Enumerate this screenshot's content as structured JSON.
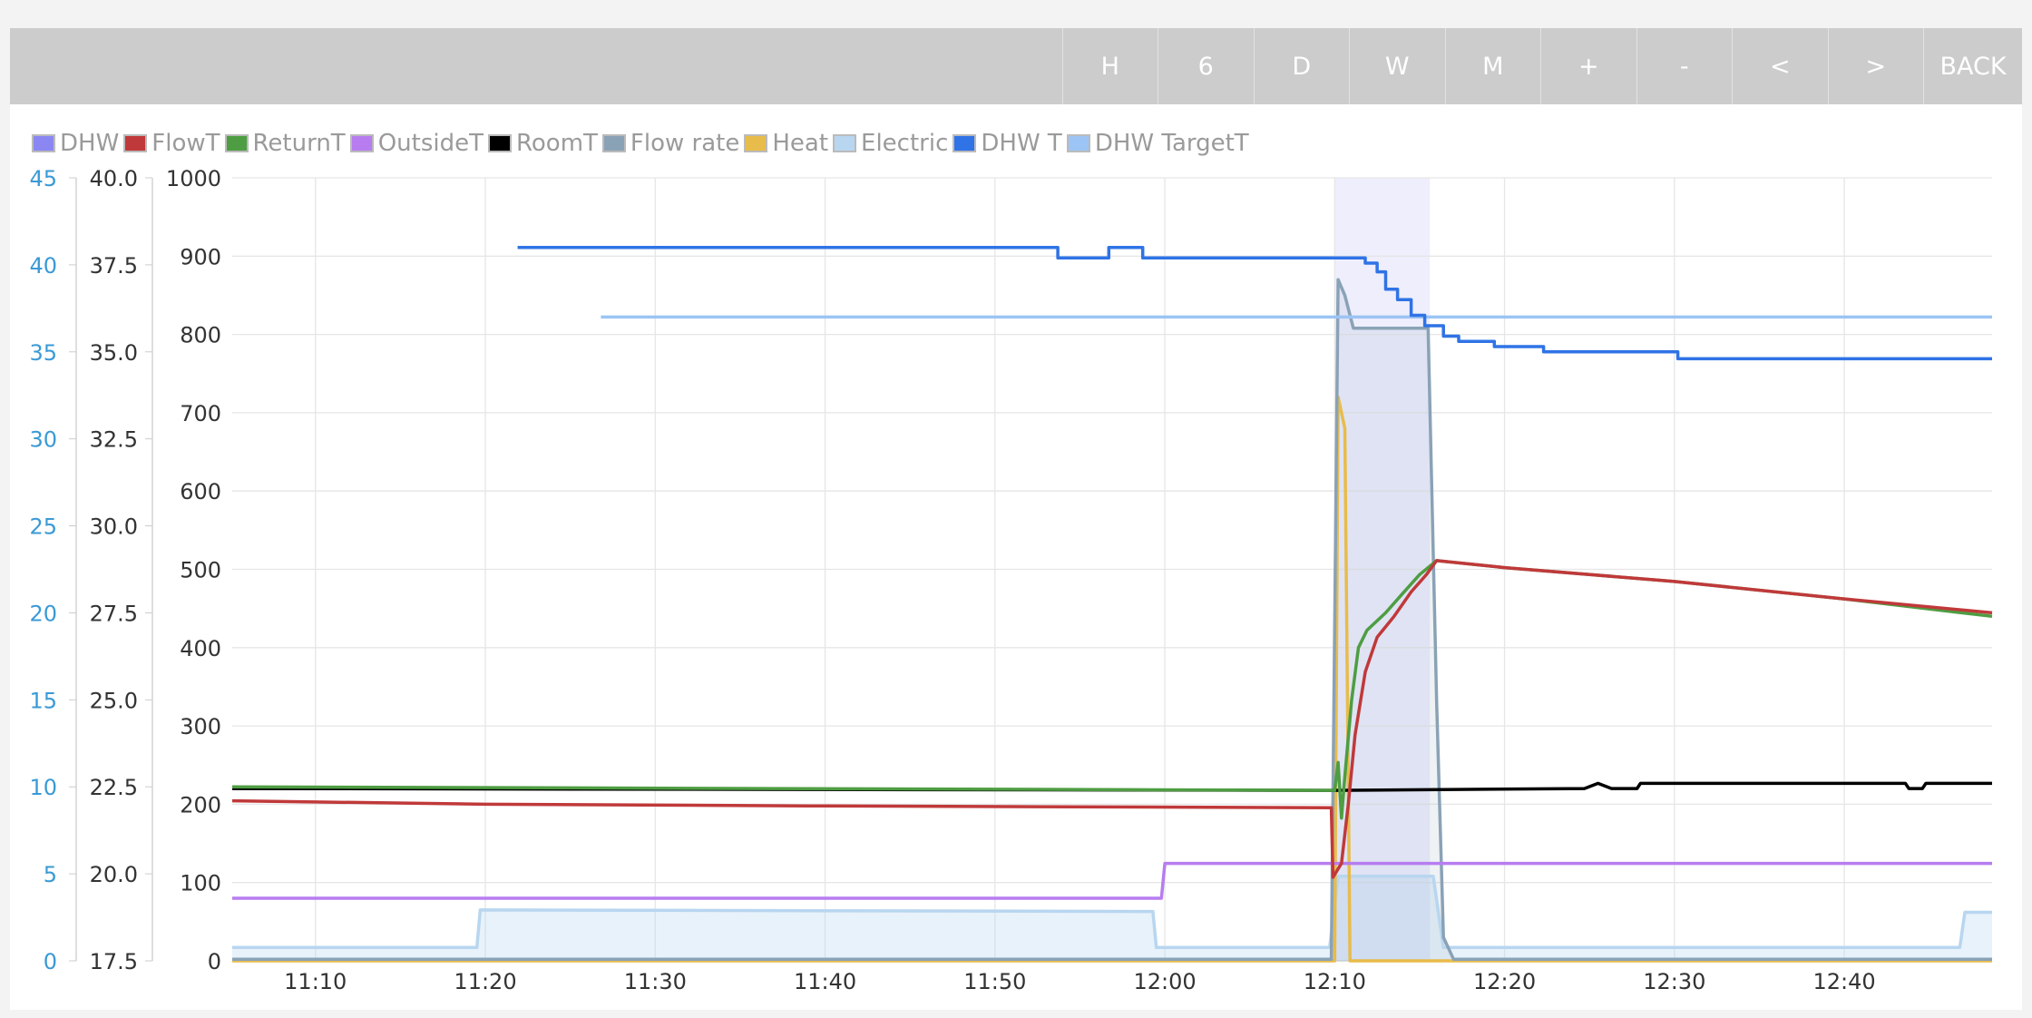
{
  "toolbar": {
    "buttons": [
      "H",
      "6",
      "D",
      "W",
      "M",
      "+",
      "-",
      "<",
      ">",
      "BACK"
    ]
  },
  "legend": [
    {
      "label": "DHW",
      "color": "#8a87f2"
    },
    {
      "label": "FlowT",
      "color": "#c0393a"
    },
    {
      "label": "ReturnT",
      "color": "#4e9d42"
    },
    {
      "label": "OutsideT",
      "color": "#b77df0"
    },
    {
      "label": "RoomT",
      "color": "#000000"
    },
    {
      "label": "Flow rate",
      "color": "#8aa2b6"
    },
    {
      "label": "Heat",
      "color": "#e8bc4a"
    },
    {
      "label": "Electric",
      "color": "#b8d6f0"
    },
    {
      "label": "DHW T",
      "color": "#2f73e6"
    },
    {
      "label": "DHW TargetT",
      "color": "#9cc4f4"
    }
  ],
  "chart_data": {
    "type": "line",
    "x_ticks": [
      "11:10",
      "11:20",
      "11:30",
      "11:40",
      "11:50",
      "12:00",
      "12:10",
      "12:20",
      "12:30",
      "12:40"
    ],
    "x_range_minutes": [
      5.1,
      108.7
    ],
    "y_axis_power": {
      "ticks": [
        "0",
        "100",
        "200",
        "300",
        "400",
        "500",
        "600",
        "700",
        "800",
        "900",
        "1000"
      ],
      "range": [
        0,
        1000
      ]
    },
    "y_axis_temp": {
      "ticks": [
        "17.5",
        "20.0",
        "22.5",
        "25.0",
        "27.5",
        "30.0",
        "32.5",
        "35.0",
        "37.5",
        "40.0"
      ],
      "range": [
        17.5,
        40.0
      ]
    },
    "y_axis_dhw": {
      "ticks": [
        "0",
        "5",
        "10",
        "15",
        "20",
        "25",
        "30",
        "35",
        "40",
        "45"
      ],
      "range": [
        0,
        45
      ],
      "color": "#3a9ad6"
    },
    "dhw_band_minutes": [
      70.0,
      75.6
    ],
    "grid": true,
    "legend_position": "top-left",
    "series": [
      {
        "name": "DHW T",
        "color": "#2f73e6",
        "axis": "dhw",
        "points": [
          [
            21.9,
            41.0
          ],
          [
            53.7,
            41.0
          ],
          [
            53.7,
            40.4
          ],
          [
            56.7,
            40.4
          ],
          [
            56.7,
            41.0
          ],
          [
            58.7,
            41.0
          ],
          [
            58.7,
            40.4
          ],
          [
            71.8,
            40.4
          ],
          [
            71.8,
            40.1
          ],
          [
            72.5,
            40.1
          ],
          [
            72.5,
            39.6
          ],
          [
            73.0,
            39.6
          ],
          [
            73.0,
            38.6
          ],
          [
            73.7,
            38.6
          ],
          [
            73.7,
            38.0
          ],
          [
            74.5,
            38.0
          ],
          [
            74.5,
            37.1
          ],
          [
            75.3,
            37.1
          ],
          [
            75.3,
            36.5
          ],
          [
            76.4,
            36.5
          ],
          [
            76.4,
            35.9
          ],
          [
            77.3,
            35.9
          ],
          [
            77.3,
            35.6
          ],
          [
            79.4,
            35.6
          ],
          [
            79.4,
            35.3
          ],
          [
            82.3,
            35.3
          ],
          [
            82.3,
            35.0
          ],
          [
            90.2,
            35.0
          ],
          [
            90.2,
            34.6
          ],
          [
            108.7,
            34.6
          ]
        ]
      },
      {
        "name": "DHW TargetT",
        "color": "#9cc4f4",
        "axis": "dhw",
        "points": [
          [
            26.8,
            37.0
          ],
          [
            108.7,
            37.0
          ]
        ]
      },
      {
        "name": "RoomT",
        "color": "#000000",
        "axis": "temp",
        "points": [
          [
            5.1,
            22.45
          ],
          [
            70.0,
            22.4
          ],
          [
            84.7,
            22.45
          ],
          [
            85.5,
            22.6
          ],
          [
            86.3,
            22.45
          ],
          [
            87.8,
            22.45
          ],
          [
            88.0,
            22.6
          ],
          [
            103.6,
            22.6
          ],
          [
            103.8,
            22.45
          ],
          [
            104.6,
            22.45
          ],
          [
            104.8,
            22.6
          ],
          [
            108.7,
            22.6
          ]
        ]
      },
      {
        "name": "ReturnT",
        "color": "#4e9d42",
        "axis": "temp",
        "points": [
          [
            5.1,
            22.5
          ],
          [
            70.0,
            22.4
          ],
          [
            70.2,
            23.2
          ],
          [
            70.4,
            21.6
          ],
          [
            70.6,
            22.8
          ],
          [
            71.0,
            25.0
          ],
          [
            71.4,
            26.5
          ],
          [
            71.9,
            27.0
          ],
          [
            73.0,
            27.5
          ],
          [
            73.9,
            28.0
          ],
          [
            75.0,
            28.6
          ],
          [
            76.0,
            29.0
          ],
          [
            80.0,
            28.8
          ],
          [
            90.0,
            28.4
          ],
          [
            100.0,
            27.9
          ],
          [
            108.7,
            27.4
          ]
        ]
      },
      {
        "name": "FlowT",
        "color": "#c0393a",
        "axis": "temp",
        "points": [
          [
            5.1,
            22.1
          ],
          [
            20.0,
            22.0
          ],
          [
            40.0,
            21.95
          ],
          [
            69.8,
            21.9
          ],
          [
            69.9,
            19.9
          ],
          [
            70.4,
            20.3
          ],
          [
            70.8,
            22.0
          ],
          [
            71.2,
            24.0
          ],
          [
            71.8,
            25.8
          ],
          [
            72.5,
            26.8
          ],
          [
            73.5,
            27.4
          ],
          [
            74.5,
            28.1
          ],
          [
            75.4,
            28.6
          ],
          [
            76.0,
            29.0
          ],
          [
            80.0,
            28.8
          ],
          [
            90.0,
            28.4
          ],
          [
            100.0,
            27.9
          ],
          [
            108.7,
            27.5
          ]
        ]
      },
      {
        "name": "OutsideT",
        "color": "#b77df0",
        "axis": "temp",
        "points": [
          [
            5.1,
            19.3
          ],
          [
            59.8,
            19.3
          ],
          [
            60.0,
            20.3
          ],
          [
            108.7,
            20.3
          ]
        ]
      },
      {
        "name": "Flow rate",
        "color": "#8aa2b6",
        "axis": "power",
        "points": [
          [
            5.1,
            2
          ],
          [
            69.8,
            2
          ],
          [
            70.2,
            870
          ],
          [
            70.6,
            850
          ],
          [
            71.1,
            808
          ],
          [
            75.5,
            808
          ],
          [
            76.0,
            330
          ],
          [
            76.4,
            30
          ],
          [
            77.0,
            2
          ],
          [
            108.7,
            2
          ]
        ]
      },
      {
        "name": "Heat",
        "color": "#e8bc4a",
        "axis": "power",
        "points": [
          [
            5.1,
            0
          ],
          [
            70.0,
            0
          ],
          [
            70.2,
            720
          ],
          [
            70.6,
            680
          ],
          [
            70.9,
            0
          ],
          [
            108.7,
            0
          ]
        ]
      },
      {
        "name": "Electric",
        "color": "#b8d6f0",
        "axis": "power",
        "points": [
          [
            5.1,
            17
          ],
          [
            19.5,
            17
          ],
          [
            19.7,
            65
          ],
          [
            59.3,
            63
          ],
          [
            59.5,
            17
          ],
          [
            69.7,
            17
          ],
          [
            70.2,
            108
          ],
          [
            75.8,
            108
          ],
          [
            76.4,
            17
          ],
          [
            106.8,
            17
          ],
          [
            107.1,
            62
          ],
          [
            108.7,
            62
          ]
        ]
      }
    ]
  }
}
